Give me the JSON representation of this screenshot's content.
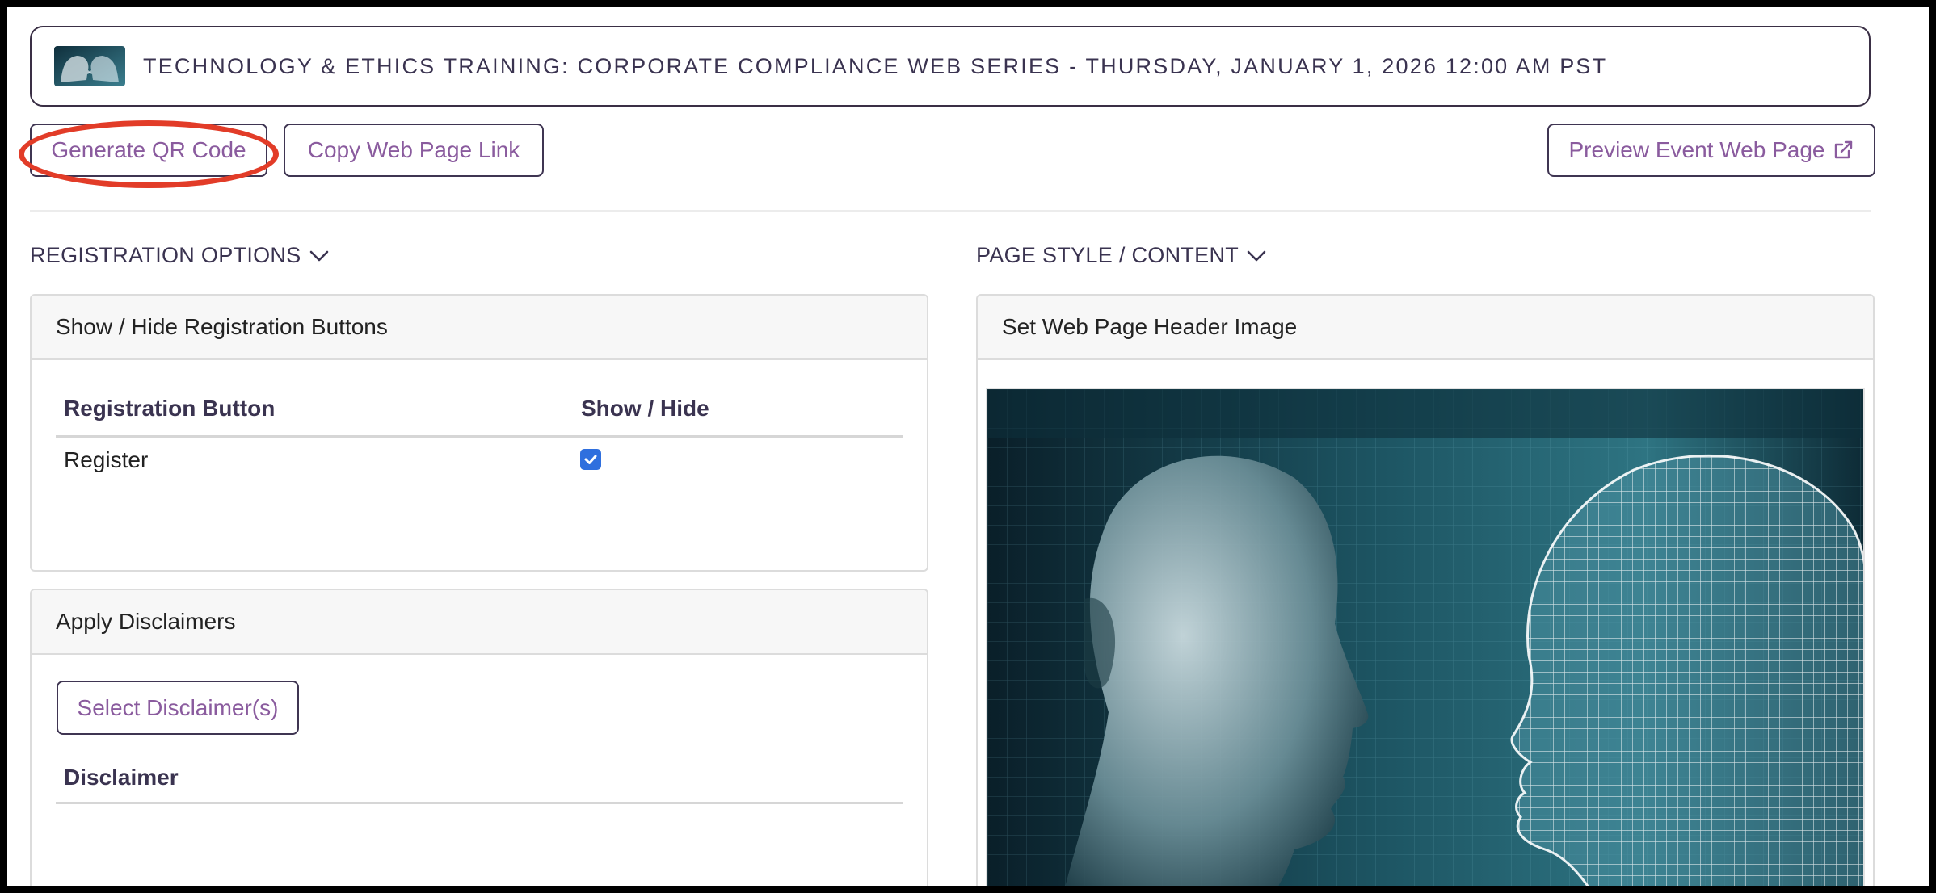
{
  "header": {
    "event_title": "TECHNOLOGY & ETHICS TRAINING: CORPORATE COMPLIANCE WEB SERIES - THURSDAY, JANUARY 1, 2026 12:00 AM PST",
    "thumbnail_icon": "event-thumbnail-image"
  },
  "toolbar": {
    "qr_label": "Generate QR Code",
    "copy_label": "Copy Web Page Link",
    "preview_label": "Preview Event Web Page",
    "preview_icon": "external-link-icon"
  },
  "sections": {
    "registration_options": "REGISTRATION OPTIONS",
    "page_style": "PAGE STYLE / CONTENT"
  },
  "registration_card": {
    "title": "Show / Hide Registration Buttons",
    "columns": [
      "Registration Button",
      "Show / Hide"
    ],
    "rows": [
      {
        "name": "Register",
        "checked": true
      }
    ]
  },
  "disclaimer_card": {
    "title": "Apply Disclaimers",
    "select_label": "Select Disclaimer(s)",
    "column": "Disclaimer"
  },
  "header_image_card": {
    "title": "Set Web Page Header Image"
  },
  "colors": {
    "accent": "#8a5b9e",
    "border": "#3f3552",
    "highlight": "#e23c28",
    "checkbox": "#2f6fde"
  }
}
